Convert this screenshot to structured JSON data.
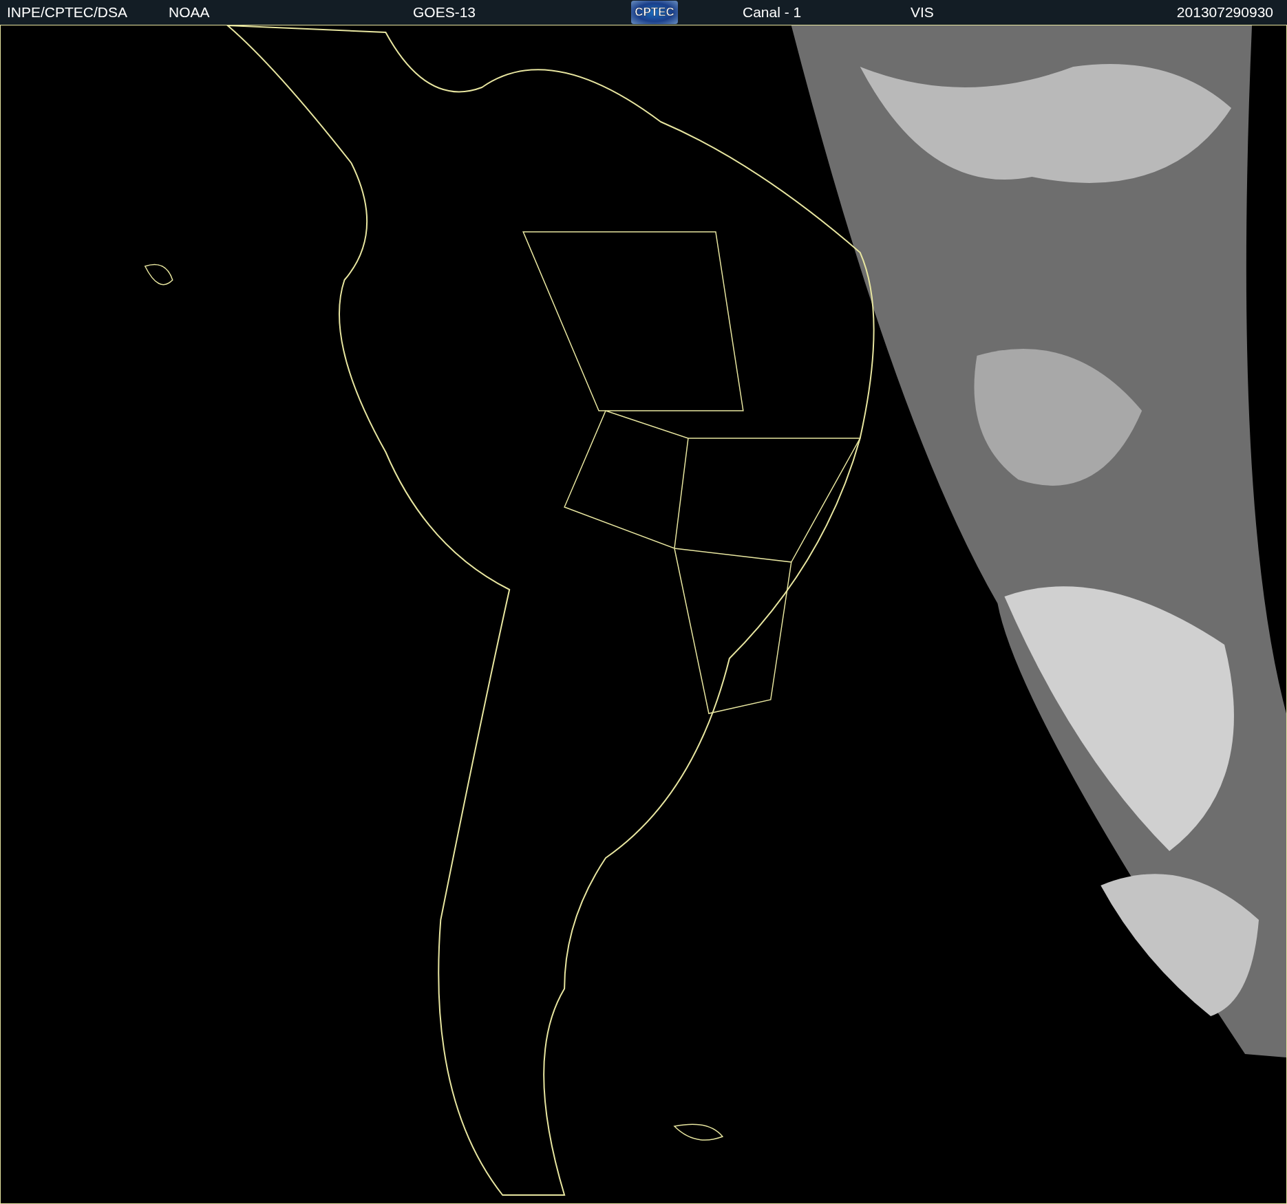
{
  "header": {
    "source": "INPE/CPTEC/DSA",
    "agency": "NOAA",
    "satellite": "GOES-13",
    "logo": "CPTEC",
    "channel": "Canal - 1",
    "band": "VIS",
    "timestamp": "201307290930"
  }
}
